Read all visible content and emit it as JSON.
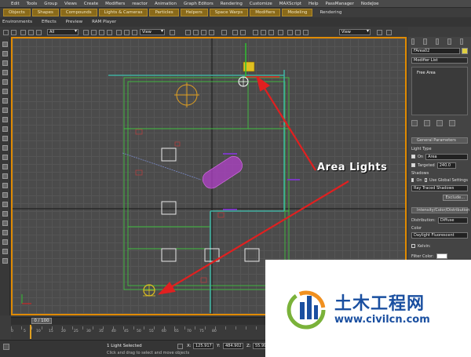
{
  "menubar": {
    "items": [
      "Edit",
      "Tools",
      "Group",
      "Views",
      "Create",
      "Modifiers",
      "reactor",
      "Animation",
      "Graph Editors",
      "Rendering",
      "Customize",
      "MAXScript",
      "Help",
      "PassManager",
      "NodeJoe"
    ]
  },
  "ribbon": {
    "tabs": [
      "Objects",
      "Shapes",
      "Compounds",
      "Lights & Cameras",
      "Particles",
      "Helpers",
      "Space Warps",
      "Modifiers",
      "Modeling",
      "Rendering"
    ]
  },
  "toolbar2": {
    "items": [
      "Environments",
      "Effects",
      "Preview",
      "RAM Player"
    ]
  },
  "toolbar3": {
    "selection_filter": "All",
    "reference_coord": "View",
    "named_selection": "View"
  },
  "command_panel": {
    "object_name": "FArea02",
    "modifier_list": "Modifier List",
    "stack_item": "Free Area",
    "general_params_header": "General Parameters",
    "light_type_label": "Light Type",
    "on_label": "On",
    "light_type_value": "Area",
    "targeted_label": "Targeted",
    "targeted_value": "240.0",
    "shadows_label": "Shadows",
    "shadows_on_label": "On",
    "use_global_label": "Use Global Settings",
    "shadow_type": "Ray Traced Shadows",
    "exclude_label": "Exclude...",
    "intensity_header": "Intensity/Color/Distribution",
    "distribution_label": "Distribution:",
    "distribution_value": "Diffuse",
    "color_label": "Color",
    "color_preset": "Daylight Fluorescent",
    "kelvin_label": "Kelvin:",
    "filter_color_label": "Filter Color:"
  },
  "timeline": {
    "frame_label": "0 / 100",
    "ruler_ticks": [
      "0",
      "5",
      "10",
      "15",
      "20",
      "25",
      "30",
      "35",
      "40",
      "45",
      "50",
      "55",
      "60",
      "65",
      "70",
      "75",
      "80"
    ]
  },
  "status": {
    "selection_text": "1 Light Selected",
    "prompt_text": "Click and drag to select and move objects",
    "x_label": "X:",
    "x_value": "125.917",
    "y_label": "Y:",
    "y_value": "484.902",
    "z_label": "Z:",
    "z_value": "55.992"
  },
  "annotation": {
    "text": "Area Lights",
    "color": "#e02020"
  },
  "watermark": {
    "brand": "土木工程网",
    "url": "www.civilcn.com"
  },
  "colors": {
    "accent": "#e08a00",
    "wire_green": "#3fbf3f",
    "wire_teal": "#3fb0a0",
    "arrow_red": "#e02020",
    "selected_box": "#cc44cc",
    "light_yellow": "#e0c020"
  }
}
